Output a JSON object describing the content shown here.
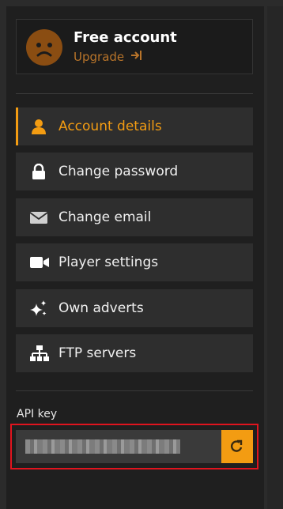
{
  "account": {
    "title": "Free account",
    "upgrade_label": "Upgrade",
    "avatar_icon": "sad-face-icon"
  },
  "menu": {
    "items": [
      {
        "label": "Account details",
        "icon": "user-icon",
        "active": true
      },
      {
        "label": "Change password",
        "icon": "lock-icon",
        "active": false
      },
      {
        "label": "Change email",
        "icon": "envelope-icon",
        "active": false
      },
      {
        "label": "Player settings",
        "icon": "video-camera-icon",
        "active": false
      },
      {
        "label": "Own adverts",
        "icon": "sparkles-icon",
        "active": false
      },
      {
        "label": "FTP servers",
        "icon": "network-icon",
        "active": false
      }
    ]
  },
  "api": {
    "label": "API key",
    "value": "••••••••••••••••••••••••••••••••",
    "refresh_icon": "refresh-icon"
  },
  "colors": {
    "accent": "#f39c12",
    "upgrade": "#b8742a",
    "highlight": "#e0141e",
    "item_bg": "#2e2e2e",
    "panel_bg": "#1f1f1f"
  }
}
